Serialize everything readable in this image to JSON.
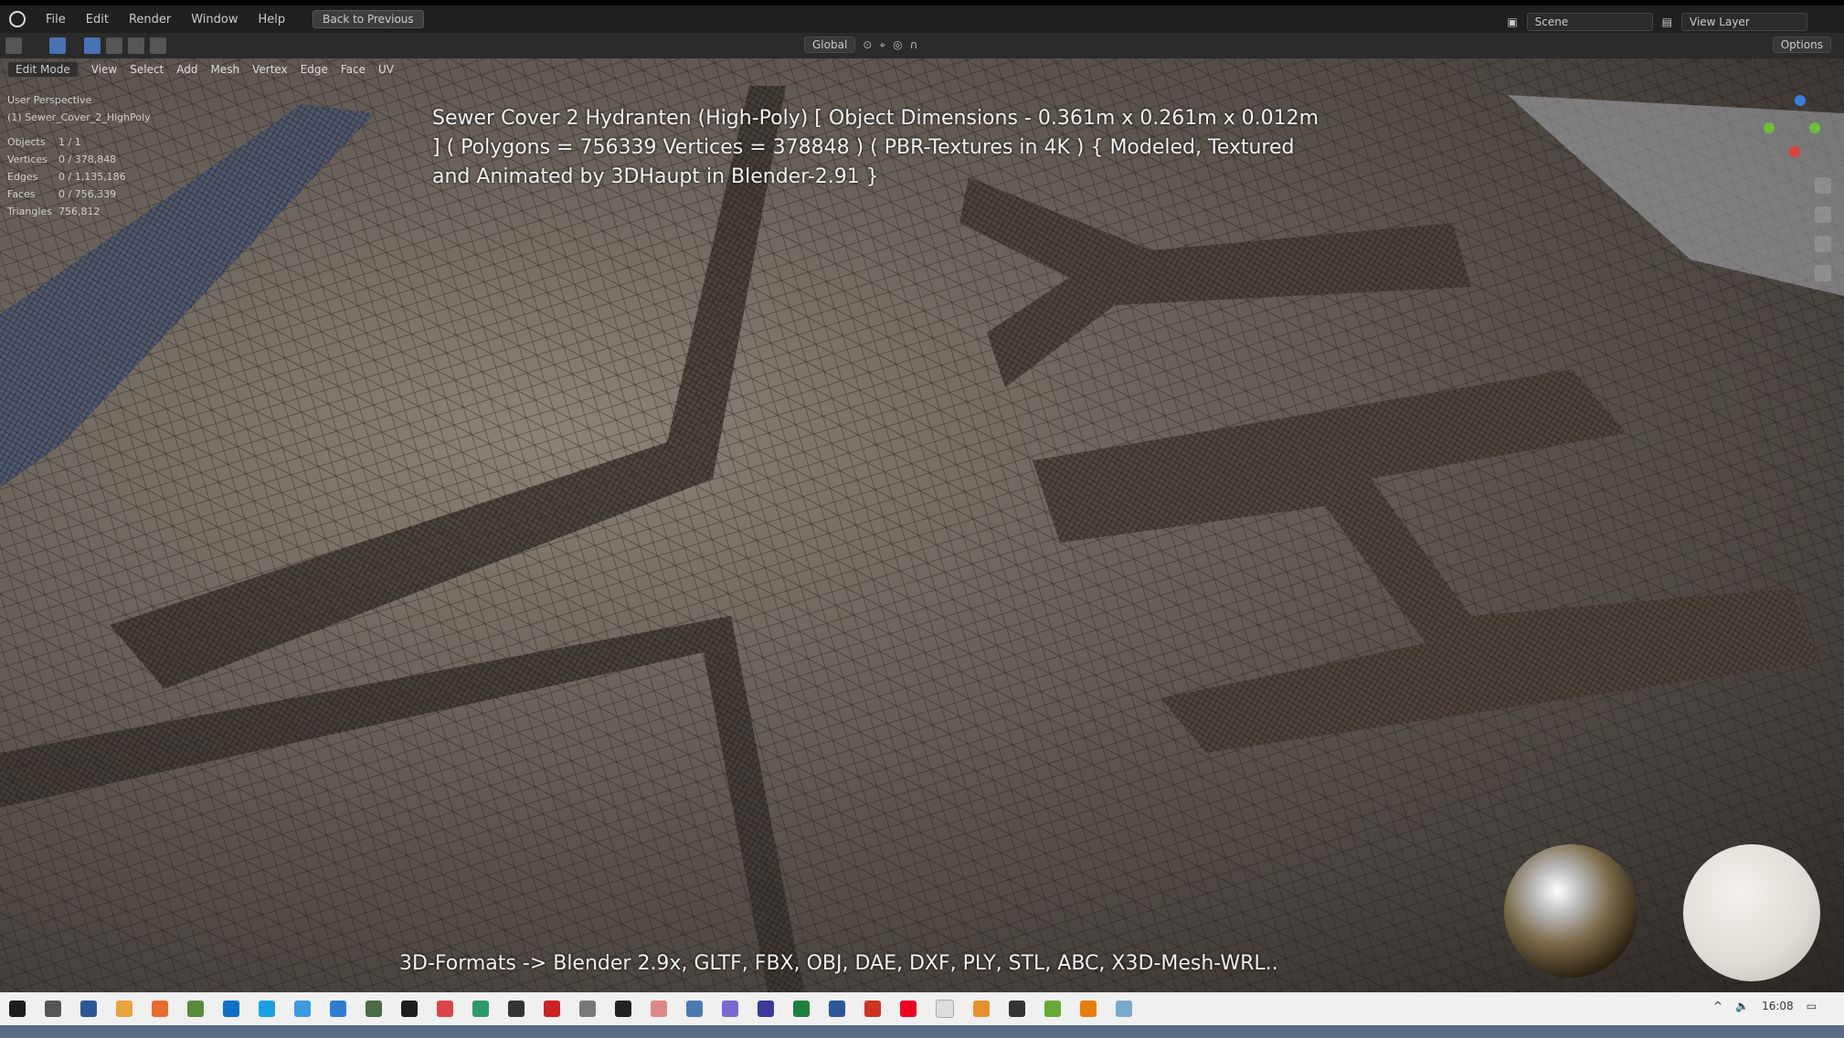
{
  "menu": [
    "File",
    "Edit",
    "Render",
    "Window",
    "Help"
  ],
  "back_button": "Back to Previous",
  "scene_name": "Scene",
  "view_layer": "View Layer",
  "orientation": "Global",
  "options_label": "Options",
  "mode": "Edit Mode",
  "edit_menu": [
    "View",
    "Select",
    "Add",
    "Mesh",
    "Vertex",
    "Edge",
    "Face",
    "UV"
  ],
  "viewport": {
    "perspective": "User Perspective",
    "object_name": "(1) Sewer_Cover_2_HighPoly"
  },
  "stats": [
    {
      "label": "Objects",
      "value": "1 / 1"
    },
    {
      "label": "Vertices",
      "value": "0 / 378,848"
    },
    {
      "label": "Edges",
      "value": "0 / 1,135,186"
    },
    {
      "label": "Faces",
      "value": "0 / 756,339"
    },
    {
      "label": "Triangles",
      "value": "756,812"
    }
  ],
  "headline": "Sewer Cover 2 Hydranten (High-Poly) [ Object Dimensions -  0.361m x 0.261m x 0.012m ] ( Polygons = 756339 Vertices = 378848 ) ( PBR-Textures in 4K ) { Modeled, Textured and Animated by 3DHaupt in Blender-2.91 }",
  "formats": "3D-Formats -> Blender 2.9x, GLTF, FBX, OBJ, DAE, DXF, PLY, STL, ABC, X3D-Mesh-WRL..",
  "clock": "16:08",
  "colors": {
    "accent": "#4772b3",
    "gizmo_x": "#e04040",
    "gizmo_y": "#6cbf3a",
    "gizmo_z": "#3a7fe0"
  }
}
